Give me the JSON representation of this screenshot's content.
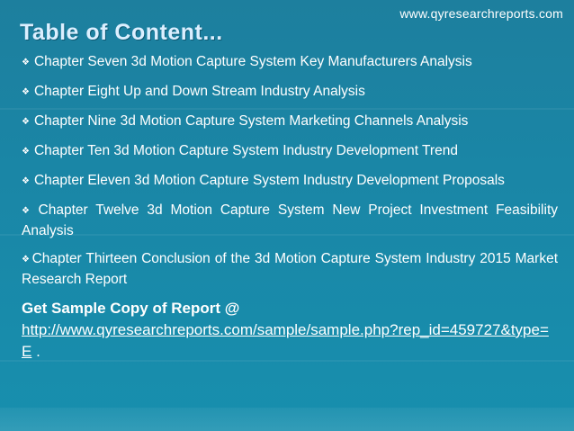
{
  "header": {
    "site_url": "www.qyresearchreports.com",
    "title": "Table of Content..."
  },
  "bullet_glyph": "❖",
  "items": [
    "Chapter Seven 3d Motion Capture System Key Manufacturers Analysis",
    "Chapter Eight Up and Down Stream Industry Analysis",
    "Chapter Nine 3d Motion Capture System Marketing Channels Analysis",
    "Chapter Ten 3d Motion Capture System Industry Development Trend",
    "Chapter Eleven 3d Motion Capture System Industry Development Proposals",
    "Chapter Twelve 3d Motion Capture System New Project Investment Feasibility Analysis",
    "Chapter Thirteen Conclusion of the 3d Motion Capture System Industry 2015 Market Research Report"
  ],
  "cta": {
    "title": "Get Sample Copy of Report @",
    "link": "http://www.qyresearchreports.com/sample/sample.php?rep_id=459727&type=E",
    "suffix": " ."
  },
  "colors": {
    "background": "#1a86a6",
    "title": "#dcefff",
    "text": "#ffffff"
  }
}
